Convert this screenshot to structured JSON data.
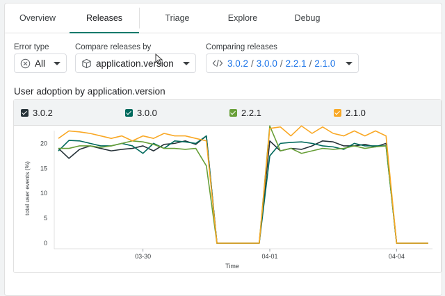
{
  "tabs": [
    {
      "label": "Overview"
    },
    {
      "label": "Releases"
    },
    {
      "label": "Triage"
    },
    {
      "label": "Explore"
    },
    {
      "label": "Debug"
    }
  ],
  "filters": {
    "error_type": {
      "label": "Error type",
      "value": "All",
      "icon": "cancel-circle-icon"
    },
    "compare_by": {
      "label": "Compare releases by",
      "value": "application.version",
      "icon": "cube-icon"
    },
    "comparing": {
      "label": "Comparing releases",
      "icon": "code-icon",
      "releases": [
        "3.0.2",
        "3.0.0",
        "2.2.1",
        "2.1.0"
      ],
      "separator": "/"
    }
  },
  "section_title": "User adoption by application.version",
  "legend": [
    {
      "name": "3.0.2",
      "color": "#263238"
    },
    {
      "name": "3.0.0",
      "color": "#00695c"
    },
    {
      "name": "2.2.1",
      "color": "#689f38"
    },
    {
      "name": "2.1.0",
      "color": "#f9a825"
    }
  ],
  "chart_data": {
    "type": "line",
    "xlabel": "Time",
    "ylabel": "total user events (%)",
    "ylim": [
      0,
      22
    ],
    "yticks": [
      0,
      5,
      10,
      15,
      20
    ],
    "xticks": [
      {
        "label": "03-30",
        "x": 8
      },
      {
        "label": "04-01",
        "x": 20
      },
      {
        "label": "04-04",
        "x": 32
      }
    ],
    "x": [
      0,
      1,
      2,
      3,
      4,
      5,
      6,
      7,
      8,
      9,
      10,
      11,
      12,
      13,
      14,
      15,
      16,
      17,
      18,
      19,
      20,
      21,
      22,
      23,
      24,
      25,
      26,
      27,
      28,
      29,
      30,
      31,
      32,
      33,
      34,
      35
    ],
    "series": [
      {
        "name": "3.0.2",
        "color": "#263238",
        "values": [
          19,
          17,
          18.8,
          19.5,
          19,
          18.5,
          18.8,
          19,
          19.5,
          18.5,
          19.8,
          20,
          20.5,
          19.8,
          21.5,
          0,
          0,
          0,
          0,
          0,
          20.5,
          18.5,
          19,
          18.8,
          19.5,
          20.5,
          20.3,
          19.5,
          19.5,
          19.8,
          19.3,
          20,
          0,
          0,
          0,
          0
        ]
      },
      {
        "name": "3.0.0",
        "color": "#00695c",
        "values": [
          18.5,
          20.6,
          20.5,
          20,
          19.5,
          19.5,
          20,
          19.5,
          18,
          20,
          19,
          20.5,
          20.3,
          20,
          21.5,
          0,
          0,
          0,
          0,
          0,
          17.5,
          20,
          20.2,
          20.3,
          20,
          19.5,
          19.3,
          18.8,
          20,
          19.5,
          19.5,
          19.5,
          0,
          0,
          0,
          0
        ]
      },
      {
        "name": "2.2.1",
        "color": "#689f38",
        "values": [
          19,
          19,
          19.5,
          19.5,
          19.2,
          19.5,
          20,
          20.5,
          20.3,
          19.8,
          19,
          19,
          18.8,
          19,
          15.5,
          0,
          0,
          0,
          0,
          0,
          23.5,
          18.5,
          19,
          18,
          18.5,
          19,
          18.8,
          19,
          19.5,
          19,
          19.3,
          19.5,
          0,
          0,
          0,
          0
        ]
      },
      {
        "name": "2.1.0",
        "color": "#f9a825",
        "values": [
          21,
          22.5,
          22.3,
          22,
          21.5,
          21,
          21.5,
          20.5,
          21.5,
          21,
          22,
          21.5,
          21.5,
          21,
          20.5,
          0,
          0,
          0,
          0,
          0,
          23,
          23.3,
          21.5,
          23.5,
          22,
          23.3,
          22,
          21.5,
          22.5,
          21.5,
          22.5,
          21.5,
          0,
          0,
          0,
          0
        ]
      }
    ]
  }
}
